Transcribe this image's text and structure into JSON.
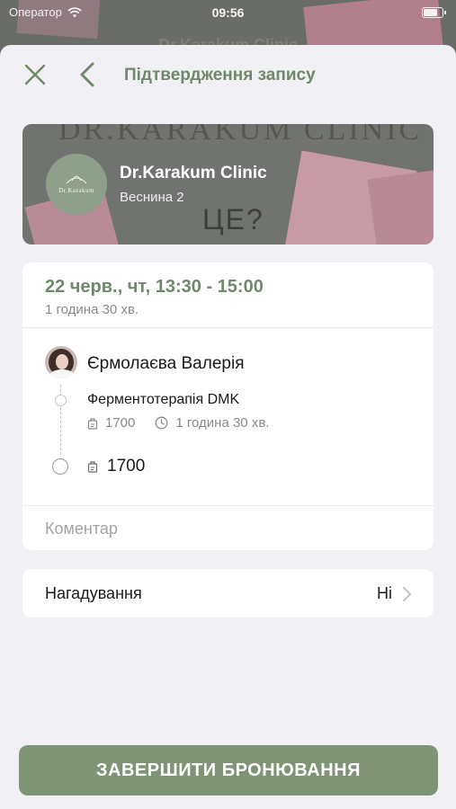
{
  "status_bar": {
    "carrier": "Оператор",
    "time": "09:56",
    "battery_level": 0.85
  },
  "backdrop": {
    "title": "Dr.Karakum Clinic"
  },
  "nav": {
    "title": "Підтвердження запису"
  },
  "clinic": {
    "logo_text": "Dr.Karakum",
    "name": "Dr.Karakum Clinic",
    "address": "Веснина 2"
  },
  "booking": {
    "datetime": "22 черв., чт, 13:30 - 15:00",
    "duration": "1 година 30 хв.",
    "staff_name": "Єрмолаєва Валерія",
    "service": {
      "name": "Ферментотерапія DMK",
      "price": "1700",
      "duration": "1 година 30 хв."
    },
    "total": "1700",
    "comment_placeholder": "Коментар"
  },
  "reminder": {
    "label": "Нагадування",
    "value": "Ні"
  },
  "complete_button": {
    "label": "ЗАВЕРШИТИ БРОНЮВАННЯ"
  },
  "colors": {
    "accent": "#6f8a6a",
    "button": "#7e9475",
    "background": "#f0f0f5"
  }
}
